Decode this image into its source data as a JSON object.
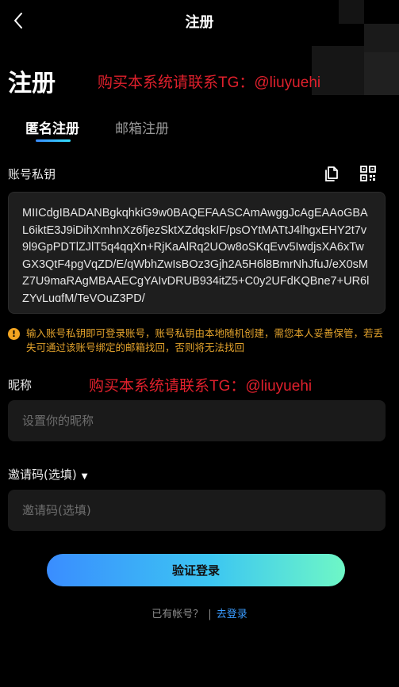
{
  "header": {
    "title": "注册"
  },
  "page": {
    "title": "注册",
    "promo_top": "购买本系统请联系TG：@liuyuehi",
    "promo_mid": "购买本系统请联系TG：@liuyuehi"
  },
  "tabs": [
    {
      "label": "匿名注册",
      "active": true
    },
    {
      "label": "邮箱注册",
      "active": false
    }
  ],
  "private_key": {
    "label": "账号私钥",
    "value": "MIICdgIBADANBgkqhkiG9w0BAQEFAASCAmAwggJcAgEAAoGBAL6iktE3J9iDihXmhnXz6fjezSktXZdqskIF/psOYtMATtJ4lhgxEHY2t7v9l9GpPDTlZJlT5q4qqXn+RjKaAlRq2UOw8oSKqEvv5IwdjsXA6xTwGX3QtF4pgVqZD/E/qWbhZwIsBOz3Gjh2A5H6l8BmrNhJfuJ/eX0sMZ7U9maRAgMBAAECgYAIvDRUB934itZ5+C0y2UFdKQBne7+UR6lZYvLuqfM/TeVQuZ3PD/",
    "warning": "输入账号私钥即可登录账号，账号私钥由本地随机创建，需您本人妥善保管，若丢失可通过该账号绑定的邮箱找回，否则将无法找回",
    "warning_icon": "!"
  },
  "nickname": {
    "label": "昵称",
    "placeholder": "设置你的昵称",
    "value": ""
  },
  "invite": {
    "label": "邀请码(选填)",
    "placeholder": "邀请码(选填)",
    "value": "",
    "caret": "▼"
  },
  "submit_label": "验证登录",
  "footer": {
    "have_account": "已有帐号？",
    "separator": "|",
    "login_link": "去登录"
  },
  "colors": {
    "accent": "#3a9cff",
    "promo": "#e0202c",
    "warning": "#e2a22c",
    "background": "#000000"
  }
}
